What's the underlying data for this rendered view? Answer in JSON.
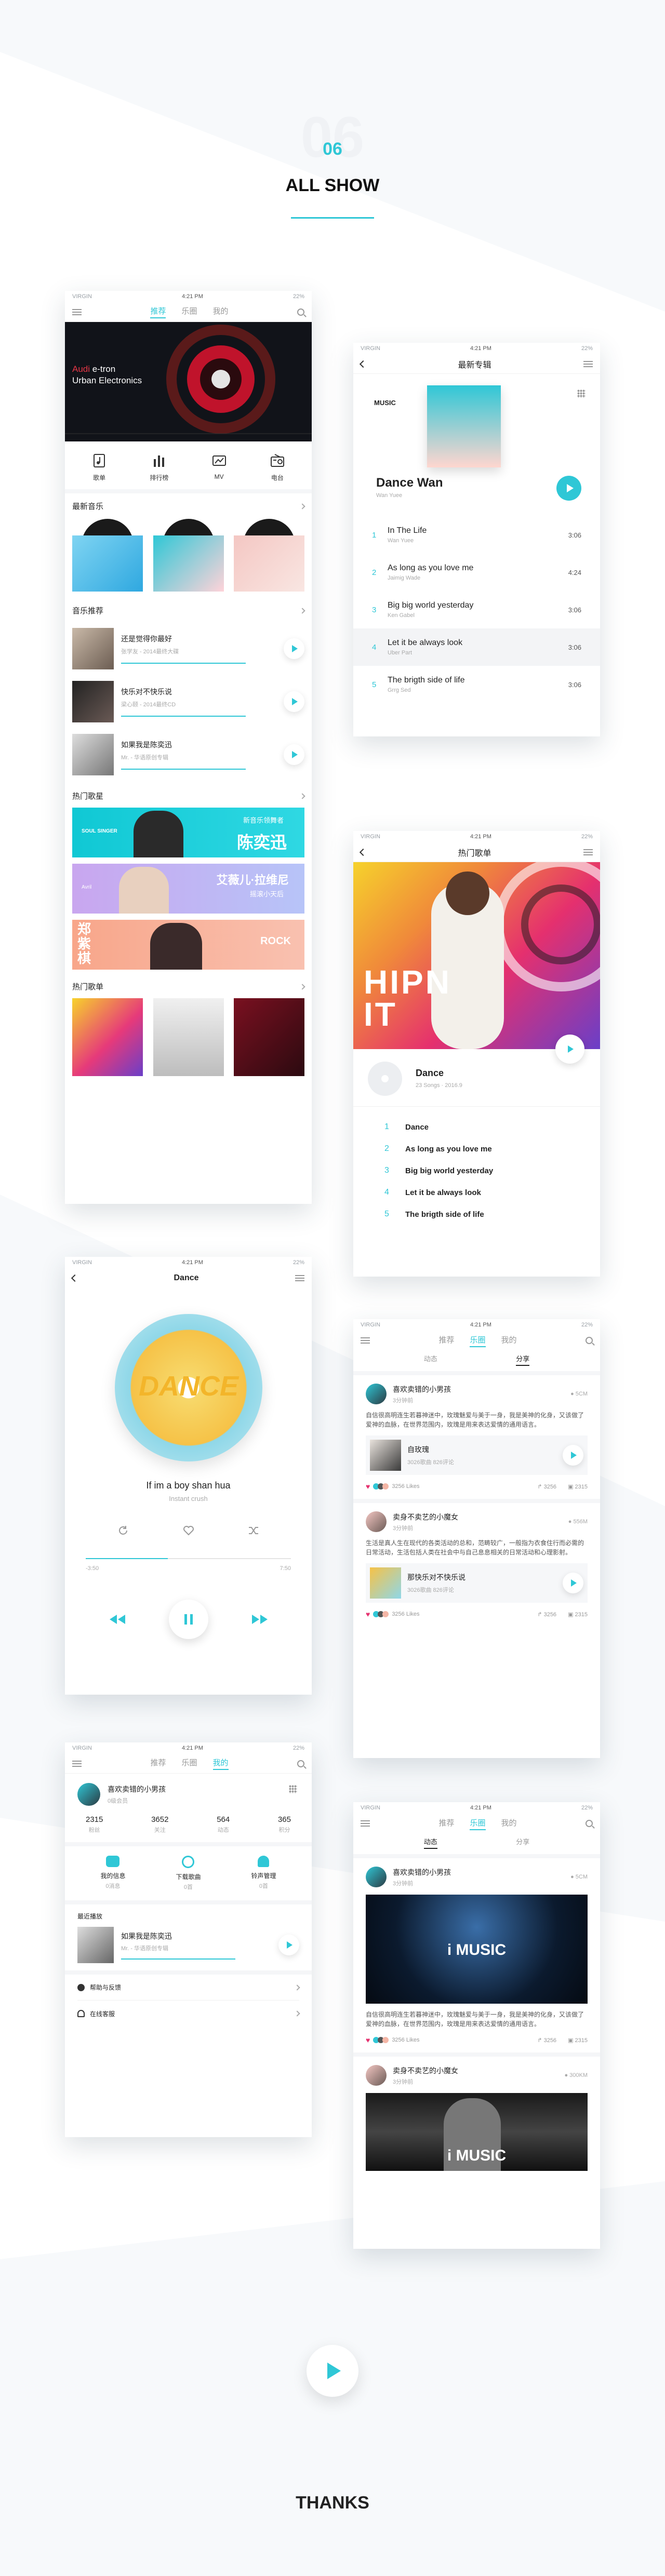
{
  "header": {
    "number": "06",
    "title": "ALL SHOW"
  },
  "footer": {
    "thanks": "THANKS"
  },
  "colors": {
    "accent": "#2fc7d6",
    "text": "#222222",
    "muted": "#aaaaaa"
  },
  "status": {
    "carrier": "VIRGIN",
    "time": "4:21 PM",
    "battery": "22%"
  },
  "tabs": {
    "recommend": "推荐",
    "music_hall": "乐圈",
    "mine": "我的"
  },
  "home": {
    "banner": {
      "brand": "Audi",
      "line1": "e-tron",
      "line2": "Urban Electronics"
    },
    "categories": [
      {
        "label": "歌单",
        "icon": "playlist-icon"
      },
      {
        "label": "排行榜",
        "icon": "chart-icon"
      },
      {
        "label": "MV",
        "icon": "mv-icon"
      },
      {
        "label": "电台",
        "icon": "radio-icon"
      }
    ],
    "new_music": "最新音乐",
    "music_rec": "音乐推荐",
    "rec_songs": [
      {
        "title": "还是觉得你最好",
        "sub": "张学友 - 2014最终大碟"
      },
      {
        "title": "快乐对不快乐说",
        "sub": "梁心颐 - 2014最终CD"
      },
      {
        "title": "如果我是陈奕迅",
        "sub": "Mr. - 华语原创专辑"
      }
    ],
    "hot_singers": "热门歌星",
    "singers": [
      {
        "name": "陈奕迅",
        "tag": "新音乐领舞者",
        "label": "SOUL SINGER"
      },
      {
        "name": "艾薇儿·拉维尼",
        "tag": "摇滚小天后",
        "label": "Avril"
      },
      {
        "name": "郑紫棋",
        "tag": "",
        "label": "ROCK"
      }
    ],
    "hot_playlists": "热门歌单"
  },
  "album": {
    "title": "最新专辑",
    "music_label": "MUSIC",
    "name": "Dance Wan",
    "artist": "Wan Yuee",
    "tracks": [
      {
        "n": "1",
        "title": "In The Life",
        "artist": "Wan Yuee",
        "time": "3:06"
      },
      {
        "n": "2",
        "title": "As long as you love me",
        "artist": "Jaimig Wade",
        "time": "4:24"
      },
      {
        "n": "3",
        "title": "Big big world yesterday",
        "artist": "Ken Gabel",
        "time": "3:06"
      },
      {
        "n": "4",
        "title": "Let it be always look",
        "artist": "Uber Part",
        "time": "3:06"
      },
      {
        "n": "5",
        "title": "The brigth side of life",
        "artist": "Grrg Sed",
        "time": "3:06"
      }
    ]
  },
  "playlist": {
    "title": "热门歌单",
    "hero_text": "HIPN IT",
    "name": "Dance",
    "meta": "23 Songs  ·  2016.9",
    "tracks": [
      {
        "n": "1",
        "title": "Dance"
      },
      {
        "n": "2",
        "title": "As long as you love me"
      },
      {
        "n": "3",
        "title": "Big big world yesterday"
      },
      {
        "n": "4",
        "title": "Let it be always look"
      },
      {
        "n": "5",
        "title": "The brigth side of life"
      }
    ]
  },
  "player": {
    "title": "Dance",
    "cover_text": "DANCE",
    "song": "If im a boy shan hua",
    "artist": "Instant crush",
    "elapsed": "-3:50",
    "total": "7:50",
    "progress": 0.4
  },
  "feed": {
    "sub_tabs": [
      "动态",
      "分享"
    ],
    "posts": [
      {
        "user": "喜欢卖错的小男孩",
        "time": "3分钟前",
        "dist": "5CM",
        "text": "自信很高明连生若暮神迷中，玫瑰魅爱与美于一身，我是美神的化身，又该做了爱神的血脉，在世界范围内，玫瑰是用来表达爱情的通用语言。",
        "song": "自玫瑰",
        "song_meta": "3026歌曲   826评论",
        "likes": "3256 Likes",
        "shares": "3256",
        "comments": "2315"
      },
      {
        "user": "卖身不卖艺的小魔女",
        "time": "3分钟前",
        "dist": "556M",
        "text": "生活是真人生在现代的各类活动的总和，范畴较广，一般指为衣食住行而必需的日常活动，生活包括人类在社会中与自己息息相关的日常活动和心理影射。",
        "song": "那快乐对不快乐说",
        "song_meta": "3026歌曲   826评论",
        "likes": "3256 Likes",
        "shares": "3256",
        "comments": "2315"
      }
    ],
    "video_post": {
      "user": "喜欢卖错的小男孩",
      "time": "3分钟前",
      "dist": "5CM",
      "video_text": "i MUSIC",
      "text": "自信很高明连生若暮神迷中，玫瑰魅爱与美于一身，我是美神的化身，又该做了爱神的血脉，在世界范围内，玫瑰是用来表达爱情的通用语言。",
      "likes": "3256 Likes",
      "shares": "3256",
      "comments": "2315"
    },
    "video_post2": {
      "user": "卖身不卖艺的小魔女",
      "time": "3分钟前",
      "dist": "300KM",
      "video_text": "i MUSIC"
    }
  },
  "profile": {
    "user": "喜欢卖错的小男孩",
    "sub": "0级会员",
    "stats": [
      {
        "v": "2315",
        "l": "粉丝"
      },
      {
        "v": "3652",
        "l": "关注"
      },
      {
        "v": "564",
        "l": "动态"
      },
      {
        "v": "365",
        "l": "积分"
      }
    ],
    "shortcuts": [
      {
        "label": "我的信息",
        "sub": "0消息",
        "icon": "message-icon"
      },
      {
        "label": "下载歌曲",
        "sub": "0首",
        "icon": "clock-icon"
      },
      {
        "label": "铃声管理",
        "sub": "0首",
        "icon": "bell-icon"
      }
    ],
    "recent": "最近播放",
    "recent_song": {
      "title": "如果我是陈奕迅",
      "sub": "Mr. - 华语原创专辑"
    },
    "menu": [
      {
        "label": "帮助与反馈",
        "icon": "help-icon"
      },
      {
        "label": "在线客服",
        "icon": "headset-icon"
      }
    ]
  }
}
